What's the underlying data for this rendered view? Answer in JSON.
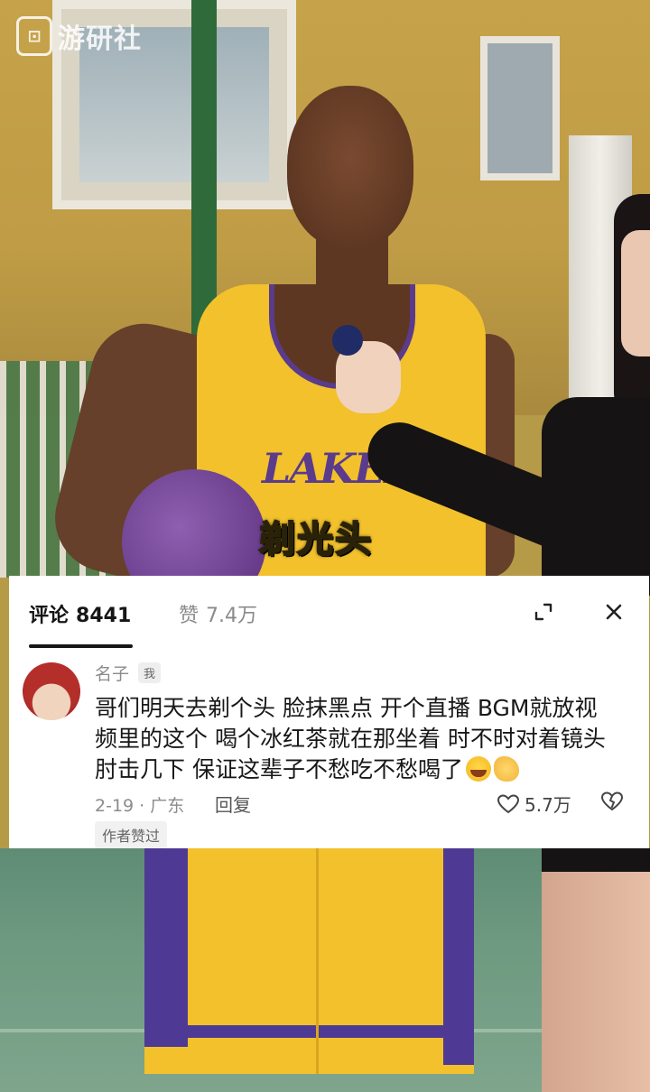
{
  "watermark": {
    "logo_glyph": "⊡",
    "text": "游研社"
  },
  "video": {
    "caption": "剃光头",
    "jersey_text": "LAKERS"
  },
  "comments_panel": {
    "tabs": [
      {
        "label": "评论",
        "count": "8441"
      },
      {
        "label": "赞",
        "count": "7.4万"
      }
    ],
    "expand_icon": "expand-icon",
    "close_icon": "close-icon"
  },
  "comment": {
    "username": "名子",
    "badge": "我",
    "text": "哥们明天去剃个头 脸抹黑点 开个直播 BGM就放视频里的这个 喝个冰红茶就在那坐着 时不时对着镜头肘击几下 保证这辈子不愁吃不愁喝了",
    "emojis": [
      "laughing-crying-emoji",
      "ok-hand-emoji"
    ],
    "date_location": "2-19 · 广东",
    "reply_label": "回复",
    "likes": "5.7万",
    "author_liked": "作者赞过"
  },
  "colors": {
    "caption_yellow": "#f5d22e",
    "jersey_yellow": "#f2c12c",
    "lakers_purple": "#5a3b8c",
    "sheet_bg": "#ffffff",
    "text_primary": "#161616",
    "text_secondary": "#8b8b8b"
  }
}
